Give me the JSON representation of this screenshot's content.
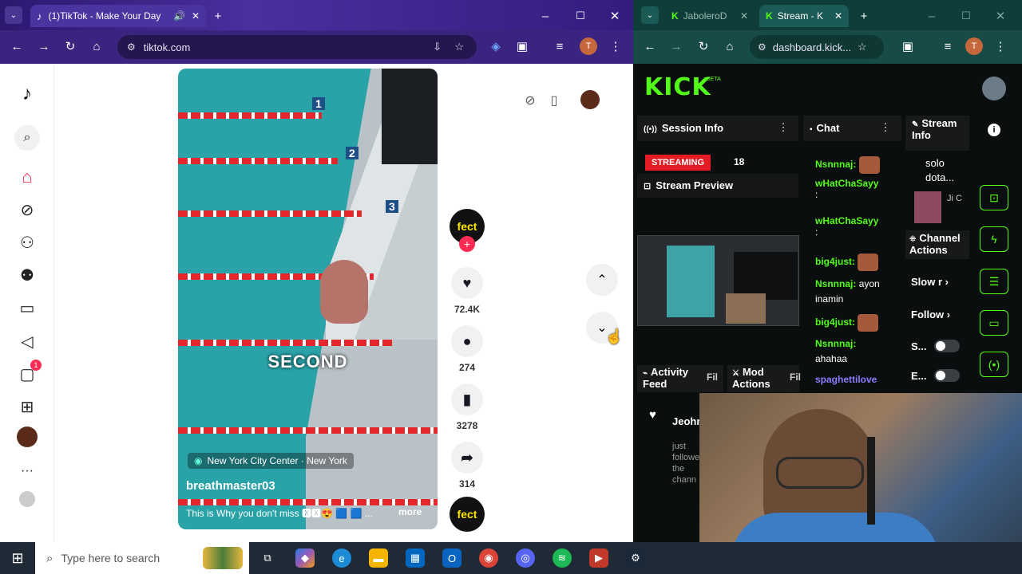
{
  "left_browser": {
    "tab_title": "(1)TikTok - Make Your Day",
    "url": "tiktok.com"
  },
  "tiktok": {
    "nav": {
      "inbox_badge": "1"
    },
    "video": {
      "overlay_text": "SECOND",
      "location": "New York City Center · New York",
      "author": "breathmaster03",
      "caption": "This is Why you don't miss 🆇🆇😍 🟦 🟦 ...",
      "more_label": "more",
      "lane_numbers": [
        "1",
        "2",
        "3"
      ]
    },
    "author_avatar_text": "fect",
    "likes": "72.4K",
    "comments": "274",
    "saves": "3278",
    "shares": "314"
  },
  "right_browser": {
    "tab1_title": "JaboleroD",
    "tab2_title": "Stream - K",
    "url": "dashboard.kick..."
  },
  "kick": {
    "logo": "KICK",
    "beta": "BETA",
    "session_info": "Session Info",
    "streaming_badge": "STREAMING",
    "viewer_count": "18",
    "stream_preview": "Stream Preview",
    "chat_title": "Chat",
    "chat": [
      {
        "user": "Nsnnnaj:",
        "msg": ""
      },
      {
        "user": "wHatChaSayy",
        "msg": ":"
      },
      {
        "user": "wHatChaSayy",
        "msg": ":"
      },
      {
        "user": "big4just:",
        "msg": ""
      },
      {
        "user": "Nsnnnaj:",
        "msg": "ayon inamin"
      },
      {
        "user": "big4just:",
        "msg": ""
      },
      {
        "user": "Nsnnnaj:",
        "msg": "ahahaa"
      },
      {
        "user": "spaghettilove",
        "msg": ""
      }
    ],
    "stream_info_title": "Stream Info",
    "stream_info_text": "solo dota...",
    "stream_info_side": "Ji C",
    "channel_actions": "Channel Actions",
    "slow_mode": "Slow r",
    "follow": "Follow",
    "toggle1": "S...",
    "toggle2": "E...",
    "activity_feed": "Activity Feed",
    "mod_actions": "Mod Actions",
    "filter_short": "Fil",
    "activity_user": "Jeohr",
    "activity_text": "just followe the chann"
  },
  "taskbar": {
    "search_placeholder": "Type here to search"
  }
}
